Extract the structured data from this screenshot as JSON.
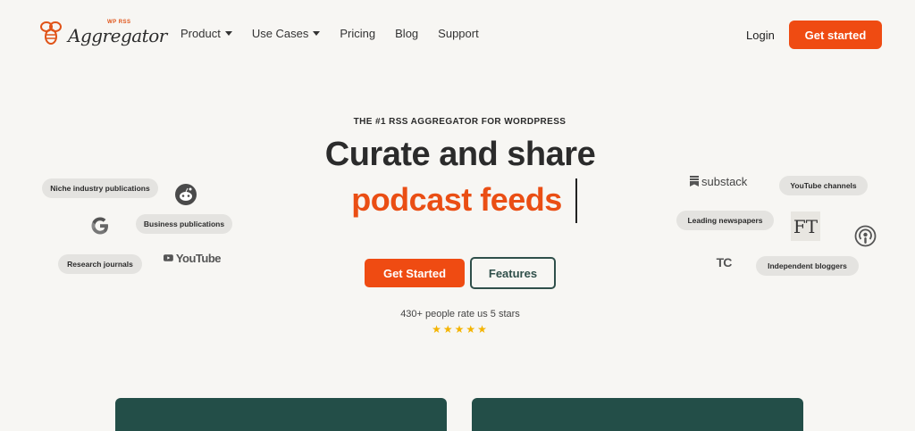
{
  "brand": {
    "tiny_label": "WP RSS",
    "name": "Aggregator",
    "accent_color": "#ef4b12",
    "dark_green": "#234e48"
  },
  "nav": {
    "items": [
      {
        "label": "Product",
        "has_caret": true
      },
      {
        "label": "Use Cases",
        "has_caret": true
      },
      {
        "label": "Pricing",
        "has_caret": false
      },
      {
        "label": "Blog",
        "has_caret": false
      },
      {
        "label": "Support",
        "has_caret": false
      }
    ],
    "login_label": "Login",
    "cta_label": "Get started"
  },
  "hero": {
    "eyebrow": "THE #1 RSS AGGREGATOR FOR WORDPRESS",
    "headline_line1": "Curate and share",
    "headline_line2": "podcast feeds",
    "primary_button": "Get Started",
    "secondary_button": "Features",
    "rating_text": "430+ people rate us 5 stars",
    "stars": "★★★★★",
    "rating_value": 5
  },
  "left_sources": {
    "pills": [
      "Niche industry publications",
      "Business publications",
      "Research journals"
    ],
    "icons": [
      "reddit-icon",
      "google-icon",
      "youtube-logo"
    ],
    "youtube_text": "YouTube"
  },
  "right_sources": {
    "pills": [
      "YouTube channels",
      "Leading newspapers",
      "Independent bloggers"
    ],
    "substack_text": "substack",
    "ft_text": "FT",
    "tc_text": "TC",
    "icons": [
      "substack-logo",
      "financial-times-logo",
      "podcast-icon",
      "techcrunch-logo"
    ]
  }
}
